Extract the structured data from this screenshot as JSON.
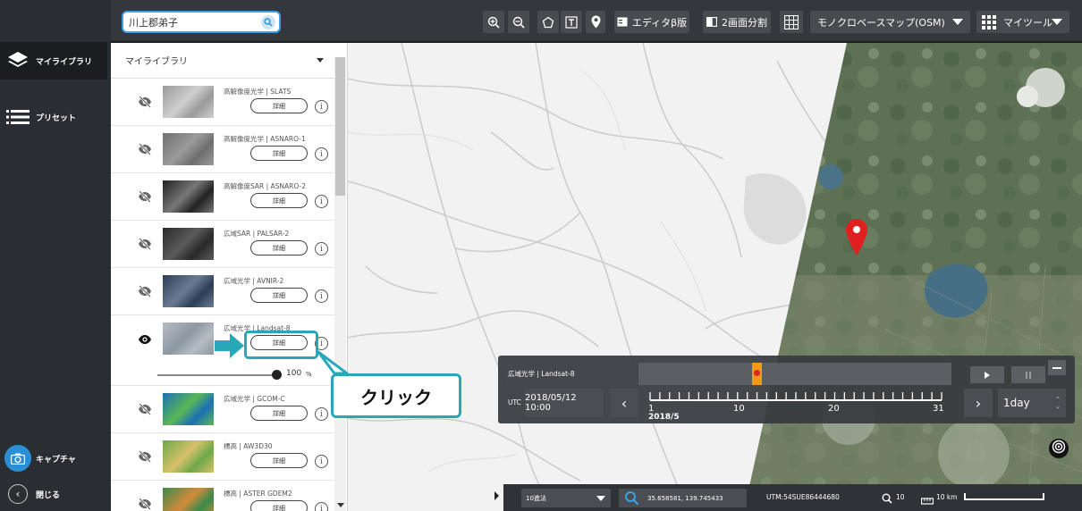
{
  "nav": {
    "items": [
      {
        "label": "マイライブラリ",
        "icon": "layers-icon"
      },
      {
        "label": "プリセット",
        "icon": "list-icon"
      }
    ],
    "capture_label": "キャプチャ",
    "close_label": "閉じる"
  },
  "toolbar": {
    "search_value": "川上郡弟子",
    "editor_label": "エディタβ版",
    "split_label": "2画面分割",
    "basemap_label": "モノクロベースマップ(OSM)",
    "mytools_label": "マイツール"
  },
  "library": {
    "header": "マイライブラリ",
    "detail_label": "詳細",
    "info_glyph": "i",
    "items": [
      {
        "title": "高解像度光学 | SLATS",
        "visible": false
      },
      {
        "title": "高解像度光学 | ASNARO-1",
        "visible": false
      },
      {
        "title": "高解像度SAR | ASNARO-2",
        "visible": false
      },
      {
        "title": "広域SAR | PALSAR-2",
        "visible": false
      },
      {
        "title": "広域光学 | AVNIR-2",
        "visible": false
      },
      {
        "title": "広域光学 | Landsat-8",
        "visible": true
      },
      {
        "title": "広域光学 | GCOM-C",
        "visible": false
      },
      {
        "title": "標高 | AW3D30",
        "visible": false
      },
      {
        "title": "標高 | ASTER GDEM2",
        "visible": false
      }
    ],
    "opacity_value": "100",
    "opacity_unit": "%"
  },
  "timeline": {
    "layer_label": "広域光学 | Landsat-8",
    "utc_label": "UTC",
    "datetime": "2018/05/12 10:00",
    "scale_labels": [
      "1",
      "10",
      "20",
      "31"
    ],
    "month_label": "2018/5",
    "step_value": "1day"
  },
  "status": {
    "period": "10進法",
    "coords": "35.658581, 139.745433",
    "utm": "UTM:54SUE86444680",
    "zoom": "10",
    "scale": "10 km"
  },
  "annotation": {
    "callout": "クリック"
  },
  "colors": {
    "accent": "#3ba1e6",
    "callout_border": "#27a7b7",
    "marker_red": "#e02020",
    "timeline_marker": "#f29a18"
  }
}
